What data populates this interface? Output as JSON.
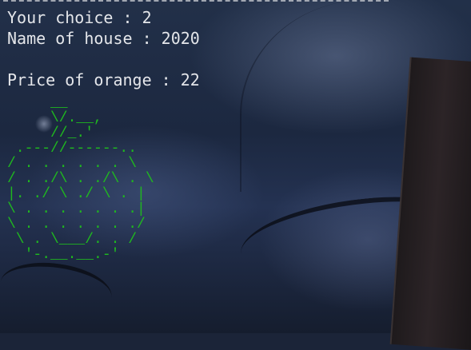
{
  "terminal": {
    "choice_line": "Your choice : 2",
    "house_line": "Name of house : 2020",
    "price_line": "Price of orange : 22",
    "ascii_orange": "     __\n     \\/.__,\n     //_.'\n .---//------..\n/ . . . . . . \\\n/ . ./\\ . ./\\ . \\\n|. ./ \\ ./ \\ . |\n\\ . . . . . . .|\n\\ . . . . . . ./\n \\ . \\___/. . /\n  '-.__.__.-'"
  },
  "colors": {
    "text": "#e4e6ea",
    "ascii_art": "#1fb81f",
    "background": "#1b2438"
  }
}
